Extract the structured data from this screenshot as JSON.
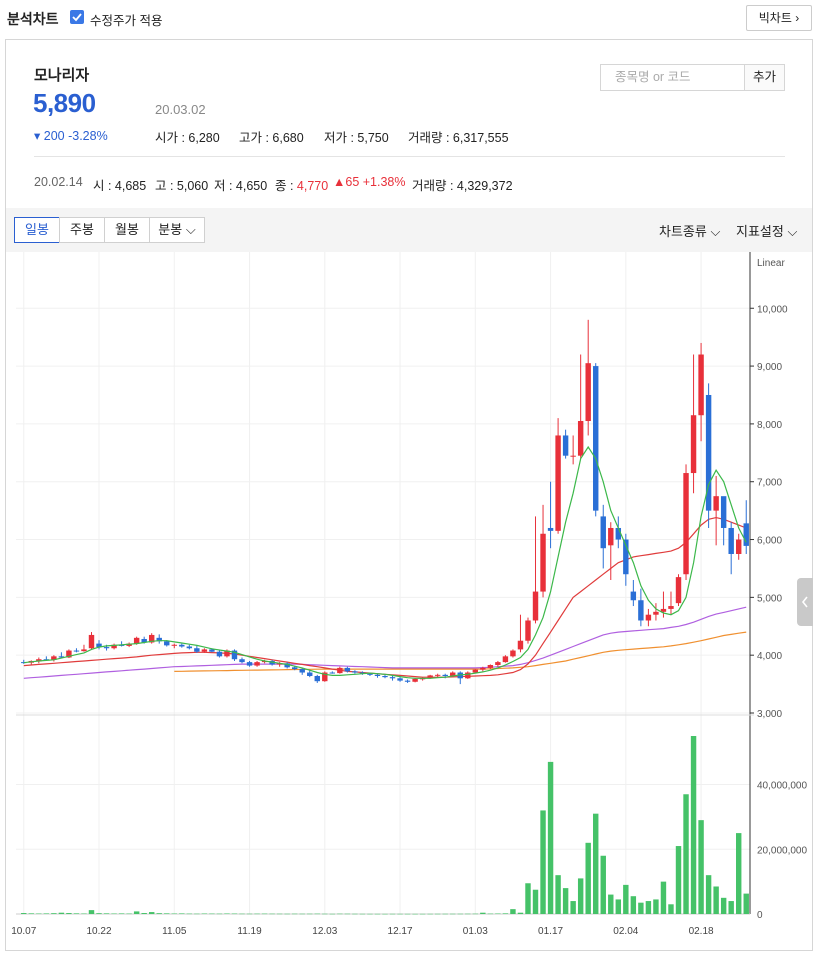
{
  "topbar": {
    "title": "분석차트",
    "adjusted_checkbox_label": "수정주가 적용",
    "adjusted_checked": true,
    "big_chart_button": "빅차트 ›"
  },
  "stock": {
    "name": "모나리자",
    "price": "5,890",
    "date": "20.03.02",
    "change": "▾ 200  -3.28%",
    "open_label": "시가 : ",
    "open": "6,280",
    "high_label": "고가 : ",
    "high": "6,680",
    "low_label": "저가 : ",
    "low": "5,750",
    "volume_label": "거래량 : ",
    "volume": "6,317,555"
  },
  "search": {
    "placeholder": "종목명 or 코드",
    "add_label": "추가"
  },
  "previous": {
    "date": "20.02.14",
    "open_label": "시 : ",
    "open": "4,685",
    "high_label": "고 : ",
    "high": "5,060",
    "low_label": "저 : ",
    "low": "4,650",
    "close_label": "종 : ",
    "close": "4,770",
    "change": "▲65  +1.38%",
    "volume_label": "거래량 : ",
    "volume": "4,329,372"
  },
  "period_tabs": [
    "일봉",
    "주봉",
    "월봉",
    "분봉 ⌵"
  ],
  "toolbar": {
    "chart_type": "차트종류 ⌵",
    "indicator": "지표설정 ⌵"
  },
  "colors": {
    "up": "#e8303a",
    "down": "#2a6fd6",
    "ma5": "#3cb84a",
    "ma20": "#e03c3c",
    "ma60": "#b060e0",
    "ma120": "#f09030",
    "volume": "#45c268"
  },
  "chart_data": {
    "type": "candlestick",
    "scale_label": "Linear",
    "price_axis_ticks": [
      "10,000",
      "9,000",
      "8,000",
      "7,000",
      "6,000",
      "5,000",
      "4,000",
      "3,000"
    ],
    "price_range": [
      3000,
      10800
    ],
    "volume_axis_ticks": [
      "40,000,000",
      "20,000,000",
      "0"
    ],
    "volume_range": [
      0,
      55000000
    ],
    "x_ticks": [
      "10.07",
      "10.22",
      "11.05",
      "11.19",
      "12.03",
      "12.17",
      "01.03",
      "01.17",
      "02.04",
      "02.18"
    ],
    "x_tick_index": [
      0,
      10,
      20,
      30,
      40,
      50,
      60,
      70,
      80,
      90
    ],
    "candles": [
      [
        3880,
        3920,
        3850,
        3870
      ],
      [
        3870,
        3910,
        3830,
        3900
      ],
      [
        3890,
        3960,
        3860,
        3930
      ],
      [
        3930,
        3980,
        3900,
        3920
      ],
      [
        3920,
        4000,
        3890,
        3980
      ],
      [
        3980,
        4050,
        3950,
        3960
      ],
      [
        3960,
        4100,
        3950,
        4080
      ],
      [
        4080,
        4120,
        4050,
        4070
      ],
      [
        4070,
        4180,
        4060,
        4100
      ],
      [
        4120,
        4400,
        4100,
        4350
      ],
      [
        4200,
        4260,
        4100,
        4140
      ],
      [
        4140,
        4180,
        4080,
        4120
      ],
      [
        4120,
        4200,
        4100,
        4180
      ],
      [
        4180,
        4240,
        4150,
        4160
      ],
      [
        4160,
        4220,
        4140,
        4200
      ],
      [
        4200,
        4320,
        4180,
        4300
      ],
      [
        4280,
        4320,
        4200,
        4220
      ],
      [
        4220,
        4380,
        4200,
        4350
      ],
      [
        4300,
        4360,
        4200,
        4240
      ],
      [
        4240,
        4260,
        4150,
        4170
      ],
      [
        4170,
        4200,
        4120,
        4180
      ],
      [
        4180,
        4200,
        4130,
        4150
      ],
      [
        4150,
        4180,
        4100,
        4120
      ],
      [
        4120,
        4160,
        4040,
        4060
      ],
      [
        4060,
        4120,
        4040,
        4100
      ],
      [
        4100,
        4120,
        4050,
        4060
      ],
      [
        4060,
        4090,
        3960,
        3980
      ],
      [
        3980,
        4100,
        3960,
        4080
      ],
      [
        4080,
        4100,
        3900,
        3930
      ],
      [
        3930,
        3960,
        3860,
        3880
      ],
      [
        3880,
        3900,
        3800,
        3820
      ],
      [
        3820,
        3900,
        3800,
        3880
      ],
      [
        3880,
        3920,
        3860,
        3900
      ],
      [
        3900,
        3920,
        3820,
        3840
      ],
      [
        3840,
        3880,
        3800,
        3860
      ],
      [
        3860,
        3880,
        3770,
        3790
      ],
      [
        3790,
        3820,
        3740,
        3760
      ],
      [
        3760,
        3780,
        3660,
        3700
      ],
      [
        3700,
        3740,
        3620,
        3640
      ],
      [
        3640,
        3660,
        3520,
        3550
      ],
      [
        3550,
        3720,
        3540,
        3700
      ],
      [
        3700,
        3720,
        3680,
        3690
      ],
      [
        3690,
        3800,
        3680,
        3780
      ],
      [
        3780,
        3800,
        3700,
        3720
      ],
      [
        3720,
        3740,
        3680,
        3700
      ],
      [
        3700,
        3720,
        3660,
        3680
      ],
      [
        3680,
        3700,
        3640,
        3660
      ],
      [
        3660,
        3680,
        3610,
        3640
      ],
      [
        3640,
        3660,
        3600,
        3620
      ],
      [
        3620,
        3640,
        3560,
        3600
      ],
      [
        3600,
        3620,
        3540,
        3560
      ],
      [
        3560,
        3580,
        3520,
        3540
      ],
      [
        3540,
        3600,
        3530,
        3590
      ],
      [
        3590,
        3620,
        3560,
        3600
      ],
      [
        3600,
        3660,
        3590,
        3650
      ],
      [
        3650,
        3680,
        3620,
        3660
      ],
      [
        3660,
        3680,
        3600,
        3640
      ],
      [
        3640,
        3720,
        3630,
        3700
      ],
      [
        3700,
        3720,
        3500,
        3600
      ],
      [
        3600,
        3720,
        3590,
        3700
      ],
      [
        3700,
        3760,
        3690,
        3750
      ],
      [
        3750,
        3800,
        3720,
        3780
      ],
      [
        3780,
        3840,
        3760,
        3830
      ],
      [
        3830,
        3900,
        3800,
        3880
      ],
      [
        3880,
        4000,
        3870,
        3980
      ],
      [
        3980,
        4100,
        3960,
        4080
      ],
      [
        4100,
        4700,
        4050,
        4250
      ],
      [
        4250,
        4650,
        4200,
        4600
      ],
      [
        4600,
        6400,
        4550,
        5100
      ],
      [
        5100,
        6600,
        5000,
        6100
      ],
      [
        6200,
        7000,
        5850,
        6150
      ],
      [
        6150,
        8100,
        6100,
        7800
      ],
      [
        7800,
        7900,
        7400,
        7450
      ],
      [
        7450,
        7800,
        7300,
        7450
      ],
      [
        7450,
        9200,
        7400,
        8050
      ],
      [
        8050,
        9800,
        7800,
        9050
      ],
      [
        9000,
        9050,
        6400,
        6500
      ],
      [
        6400,
        6600,
        5500,
        5850
      ],
      [
        5900,
        6300,
        5300,
        6200
      ],
      [
        6200,
        6400,
        5850,
        6000
      ],
      [
        6000,
        6100,
        5200,
        5400
      ],
      [
        5100,
        5300,
        4850,
        4950
      ],
      [
        4950,
        5150,
        4500,
        4600
      ],
      [
        4600,
        4800,
        4500,
        4700
      ],
      [
        4700,
        4900,
        4600,
        4750
      ],
      [
        4750,
        5100,
        4650,
        4800
      ],
      [
        4800,
        5100,
        4700,
        4850
      ],
      [
        4900,
        5400,
        4850,
        5350
      ],
      [
        5400,
        7300,
        5300,
        7150
      ],
      [
        7150,
        9200,
        6800,
        8150
      ],
      [
        8150,
        9400,
        7700,
        9200
      ],
      [
        8500,
        8700,
        6200,
        6500
      ],
      [
        6500,
        7100,
        5900,
        6750
      ],
      [
        6750,
        6700,
        5900,
        6200
      ],
      [
        6200,
        6300,
        5400,
        5750
      ],
      [
        5750,
        6100,
        5650,
        6000
      ],
      [
        6280,
        6680,
        5750,
        5890
      ]
    ],
    "ma5": [
      3870,
      3885,
      3900,
      3910,
      3920,
      3950,
      3980,
      4010,
      4040,
      4100,
      4140,
      4160,
      4170,
      4180,
      4190,
      4200,
      4220,
      4240,
      4250,
      4250,
      4230,
      4210,
      4190,
      4170,
      4140,
      4110,
      4090,
      4070,
      4050,
      4010,
      3970,
      3930,
      3900,
      3880,
      3860,
      3840,
      3810,
      3780,
      3740,
      3700,
      3670,
      3650,
      3650,
      3660,
      3670,
      3680,
      3690,
      3680,
      3670,
      3650,
      3630,
      3610,
      3600,
      3600,
      3600,
      3610,
      3620,
      3640,
      3660,
      3670,
      3690,
      3710,
      3740,
      3780,
      3830,
      3890,
      3960,
      4100,
      4350,
      4650,
      5100,
      5700,
      6300,
      6800,
      7400,
      7600,
      7400,
      7000,
      6500,
      6200,
      5900,
      5600,
      5200,
      4950,
      4800,
      4730,
      4700,
      4770,
      5000,
      5600,
      6400,
      6950,
      7200,
      7000,
      6600,
      6200,
      5950
    ],
    "ma20": [
      3820,
      3830,
      3840,
      3850,
      3860,
      3870,
      3880,
      3890,
      3900,
      3910,
      3920,
      3930,
      3940,
      3950,
      3960,
      3970,
      3985,
      4000,
      4010,
      4020,
      4030,
      4040,
      4045,
      4050,
      4050,
      4045,
      4040,
      4030,
      4020,
      4000,
      3980,
      3960,
      3940,
      3920,
      3900,
      3880,
      3860,
      3840,
      3820,
      3800,
      3780,
      3760,
      3740,
      3720,
      3710,
      3700,
      3690,
      3680,
      3670,
      3660,
      3650,
      3640,
      3630,
      3620,
      3620,
      3620,
      3620,
      3625,
      3630,
      3635,
      3640,
      3645,
      3650,
      3660,
      3680,
      3700,
      3750,
      3850,
      4000,
      4200,
      4400,
      4600,
      4800,
      5000,
      5100,
      5200,
      5300,
      5400,
      5500,
      5600,
      5650,
      5700,
      5720,
      5740,
      5760,
      5780,
      5800,
      5850,
      5950,
      6100,
      6250,
      6350,
      6380,
      6350,
      6300,
      6250,
      6200
    ],
    "ma60": [
      3600,
      3610,
      3620,
      3630,
      3640,
      3650,
      3660,
      3670,
      3680,
      3690,
      3700,
      3710,
      3720,
      3730,
      3740,
      3750,
      3760,
      3770,
      3780,
      3790,
      3800,
      3805,
      3810,
      3815,
      3820,
      3825,
      3830,
      3835,
      3840,
      3845,
      3845,
      3845,
      3845,
      3845,
      3845,
      3845,
      3845,
      3840,
      3835,
      3830,
      3825,
      3820,
      3815,
      3810,
      3805,
      3800,
      3795,
      3790,
      3785,
      3780,
      3780,
      3780,
      3780,
      3780,
      3780,
      3780,
      3780,
      3780,
      3780,
      3780,
      3780,
      3785,
      3790,
      3800,
      3810,
      3820,
      3840,
      3870,
      3910,
      3950,
      4000,
      4050,
      4100,
      4150,
      4200,
      4250,
      4300,
      4350,
      4380,
      4400,
      4410,
      4420,
      4430,
      4440,
      4450,
      4460,
      4480,
      4500,
      4530,
      4570,
      4620,
      4670,
      4710,
      4740,
      4770,
      4800,
      4830
    ],
    "ma120": [
      null,
      null,
      null,
      null,
      null,
      null,
      null,
      null,
      null,
      null,
      null,
      null,
      null,
      null,
      null,
      null,
      null,
      null,
      null,
      null,
      3720,
      3722,
      3724,
      3726,
      3728,
      3730,
      3732,
      3734,
      3736,
      3738,
      3740,
      3742,
      3744,
      3746,
      3748,
      3750,
      3752,
      3754,
      3756,
      3758,
      3760,
      3760,
      3760,
      3760,
      3760,
      3760,
      3760,
      3760,
      3760,
      3760,
      3760,
      3760,
      3760,
      3760,
      3760,
      3760,
      3760,
      3760,
      3760,
      3760,
      3760,
      3760,
      3765,
      3770,
      3775,
      3780,
      3790,
      3800,
      3820,
      3840,
      3860,
      3880,
      3900,
      3930,
      3960,
      3990,
      4020,
      4050,
      4070,
      4085,
      4095,
      4105,
      4115,
      4125,
      4135,
      4145,
      4160,
      4180,
      4200,
      4225,
      4250,
      4280,
      4310,
      4340,
      4360,
      4380,
      4400
    ],
    "volume": [
      300000,
      200000,
      150000,
      180000,
      250000,
      400000,
      300000,
      200000,
      150000,
      1200000,
      250000,
      200000,
      150000,
      180000,
      140000,
      800000,
      300000,
      600000,
      250000,
      200000,
      150000,
      180000,
      120000,
      100000,
      150000,
      130000,
      110000,
      160000,
      140000,
      100000,
      90000,
      110000,
      120000,
      100000,
      90000,
      80000,
      95000,
      85000,
      90000,
      110000,
      80000,
      60000,
      100000,
      90000,
      70000,
      60000,
      55000,
      50000,
      45000,
      60000,
      55000,
      50000,
      45000,
      50000,
      60000,
      65000,
      70000,
      75000,
      80000,
      90000,
      100000,
      400000,
      120000,
      150000,
      200000,
      1500000,
      400000,
      9500000,
      7500000,
      32000000,
      47000000,
      12000000,
      8000000,
      4000000,
      11000000,
      22000000,
      31000000,
      18000000,
      6000000,
      4500000,
      9000000,
      5500000,
      3500000,
      4000000,
      4500000,
      10000000,
      3000000,
      21000000,
      37000000,
      55000000,
      29000000,
      12000000,
      8500000,
      5000000,
      4000000,
      25000000,
      6300000
    ]
  }
}
